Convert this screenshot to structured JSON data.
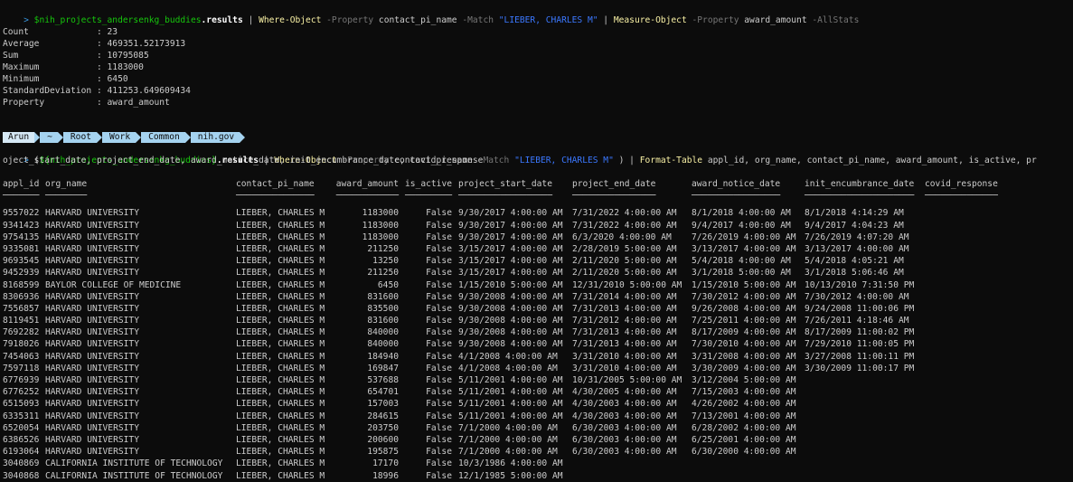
{
  "colors": {
    "background": "#0c0c0c",
    "text": "#cccccc",
    "variable": "#16c60c",
    "command": "#f9f1a5",
    "parameter": "#767676",
    "string": "#3b78ff",
    "prompt_caret": "#3a96dd",
    "prompt_segment": "#a5d3f0"
  },
  "command1": {
    "caret": ">",
    "variable": "$nih_projects_andersenkg_buddies",
    "member": ".results",
    "pipe1": " | ",
    "where": "Where-Object",
    "p1": " -Property ",
    "a1": "contact_pi_name",
    "p2": " -Match ",
    "s1": "\"LIEBER, CHARLES M\"",
    "pipe2": " | ",
    "measure": "Measure-Object",
    "p3": " -Property ",
    "a2": "award_amount",
    "p4": " -AllStats"
  },
  "stats": [
    {
      "label": "Count             ",
      "value": ": 23"
    },
    {
      "label": "Average           ",
      "value": ": 469351.52173913"
    },
    {
      "label": "Sum               ",
      "value": ": 10795085"
    },
    {
      "label": "Maximum           ",
      "value": ": 1183000"
    },
    {
      "label": "Minimum           ",
      "value": ": 6450"
    },
    {
      "label": "StandardDeviation ",
      "value": ": 411253.649609434"
    },
    {
      "label": "Property          ",
      "value": ": award_amount"
    }
  ],
  "prompt": {
    "user": "Arun",
    "segments": [
      "~",
      "Root",
      "Work",
      "Common",
      "nih.gov"
    ]
  },
  "command2": {
    "caret": ">",
    "open": "(",
    "variable": "${nih_projects_andersenkg_buddies}",
    "member": ".results",
    "pipe1": " | ",
    "where": "Where-Object",
    "p1": " -Property ",
    "a1": "contact_pi_name",
    "p2": " -Match ",
    "s1": "\"LIEBER, CHARLES M\"",
    "close": " ) | ",
    "format": "Format-Table",
    "args1": " appl_id, org_name, contact_pi_name, award_amount, is_active, pr",
    "args2": "oject_start_date, project_end_date, award_notice_date, init_encumbrance_date, covid_response"
  },
  "table": {
    "headers": [
      "appl_id",
      "org_name",
      "contact_pi_name",
      "award_amount",
      "is_active",
      "project_start_date",
      "project_end_date",
      "award_notice_date",
      "init_encumbrance_date",
      "covid_response"
    ],
    "underlines": [
      "───────",
      "────────",
      "───────────────",
      "────────────",
      "─────────",
      "──────────────────",
      "────────────────",
      "─────────────────",
      "─────────────────────",
      "──────────────"
    ],
    "rows": [
      [
        "9557022",
        "HARVARD UNIVERSITY",
        "LIEBER, CHARLES M",
        "1183000",
        "False",
        "9/30/2017 4:00:00 AM",
        "7/31/2022 4:00:00 AM",
        "8/1/2018 4:00:00 AM",
        "8/1/2018 4:14:29 AM",
        ""
      ],
      [
        "9341423",
        "HARVARD UNIVERSITY",
        "LIEBER, CHARLES M",
        "1183000",
        "False",
        "9/30/2017 4:00:00 AM",
        "7/31/2022 4:00:00 AM",
        "9/4/2017 4:00:00 AM",
        "9/4/2017 4:04:23 AM",
        ""
      ],
      [
        "9754135",
        "HARVARD UNIVERSITY",
        "LIEBER, CHARLES M",
        "1183000",
        "False",
        "9/30/2017 4:00:00 AM",
        "6/3/2020 4:00:00 AM",
        "7/26/2019 4:00:00 AM",
        "7/26/2019 4:07:20 AM",
        ""
      ],
      [
        "9335081",
        "HARVARD UNIVERSITY",
        "LIEBER, CHARLES M",
        "211250",
        "False",
        "3/15/2017 4:00:00 AM",
        "2/28/2019 5:00:00 AM",
        "3/13/2017 4:00:00 AM",
        "3/13/2017 4:00:00 AM",
        ""
      ],
      [
        "9693545",
        "HARVARD UNIVERSITY",
        "LIEBER, CHARLES M",
        "13250",
        "False",
        "3/15/2017 4:00:00 AM",
        "2/11/2020 5:00:00 AM",
        "5/4/2018 4:00:00 AM",
        "5/4/2018 4:05:21 AM",
        ""
      ],
      [
        "9452939",
        "HARVARD UNIVERSITY",
        "LIEBER, CHARLES M",
        "211250",
        "False",
        "3/15/2017 4:00:00 AM",
        "2/11/2020 5:00:00 AM",
        "3/1/2018 5:00:00 AM",
        "3/1/2018 5:06:46 AM",
        ""
      ],
      [
        "8168599",
        "BAYLOR COLLEGE OF MEDICINE",
        "LIEBER, CHARLES M",
        "6450",
        "False",
        "1/15/2010 5:00:00 AM",
        "12/31/2010 5:00:00 AM",
        "1/15/2010 5:00:00 AM",
        "10/13/2010 7:31:50 PM",
        ""
      ],
      [
        "8306936",
        "HARVARD UNIVERSITY",
        "LIEBER, CHARLES M",
        "831600",
        "False",
        "9/30/2008 4:00:00 AM",
        "7/31/2014 4:00:00 AM",
        "7/30/2012 4:00:00 AM",
        "7/30/2012 4:00:00 AM",
        ""
      ],
      [
        "7556857",
        "HARVARD UNIVERSITY",
        "LIEBER, CHARLES M",
        "835500",
        "False",
        "9/30/2008 4:00:00 AM",
        "7/31/2013 4:00:00 AM",
        "9/26/2008 4:00:00 AM",
        "9/24/2008 11:00:06 PM",
        ""
      ],
      [
        "8119451",
        "HARVARD UNIVERSITY",
        "LIEBER, CHARLES M",
        "831600",
        "False",
        "9/30/2008 4:00:00 AM",
        "7/31/2012 4:00:00 AM",
        "7/25/2011 4:00:00 AM",
        "7/26/2011 4:18:46 AM",
        ""
      ],
      [
        "7692282",
        "HARVARD UNIVERSITY",
        "LIEBER, CHARLES M",
        "840000",
        "False",
        "9/30/2008 4:00:00 AM",
        "7/31/2013 4:00:00 AM",
        "8/17/2009 4:00:00 AM",
        "8/17/2009 11:00:02 PM",
        ""
      ],
      [
        "7918026",
        "HARVARD UNIVERSITY",
        "LIEBER, CHARLES M",
        "840000",
        "False",
        "9/30/2008 4:00:00 AM",
        "7/31/2013 4:00:00 AM",
        "7/30/2010 4:00:00 AM",
        "7/29/2010 11:00:05 PM",
        ""
      ],
      [
        "7454063",
        "HARVARD UNIVERSITY",
        "LIEBER, CHARLES M",
        "184940",
        "False",
        "4/1/2008 4:00:00 AM",
        "3/31/2010 4:00:00 AM",
        "3/31/2008 4:00:00 AM",
        "3/27/2008 11:00:11 PM",
        ""
      ],
      [
        "7597118",
        "HARVARD UNIVERSITY",
        "LIEBER, CHARLES M",
        "169847",
        "False",
        "4/1/2008 4:00:00 AM",
        "3/31/2010 4:00:00 AM",
        "3/30/2009 4:00:00 AM",
        "3/30/2009 11:00:17 PM",
        ""
      ],
      [
        "6776939",
        "HARVARD UNIVERSITY",
        "LIEBER, CHARLES M",
        "537688",
        "False",
        "5/11/2001 4:00:00 AM",
        "10/31/2005 5:00:00 AM",
        "3/12/2004 5:00:00 AM",
        "",
        ""
      ],
      [
        "6776252",
        "HARVARD UNIVERSITY",
        "LIEBER, CHARLES M",
        "654701",
        "False",
        "5/11/2001 4:00:00 AM",
        "4/30/2005 4:00:00 AM",
        "7/15/2003 4:00:00 AM",
        "",
        ""
      ],
      [
        "6515093",
        "HARVARD UNIVERSITY",
        "LIEBER, CHARLES M",
        "157003",
        "False",
        "5/11/2001 4:00:00 AM",
        "4/30/2003 4:00:00 AM",
        "4/26/2002 4:00:00 AM",
        "",
        ""
      ],
      [
        "6335311",
        "HARVARD UNIVERSITY",
        "LIEBER, CHARLES M",
        "284615",
        "False",
        "5/11/2001 4:00:00 AM",
        "4/30/2003 4:00:00 AM",
        "7/13/2001 4:00:00 AM",
        "",
        ""
      ],
      [
        "6520054",
        "HARVARD UNIVERSITY",
        "LIEBER, CHARLES M",
        "203750",
        "False",
        "7/1/2000 4:00:00 AM",
        "6/30/2003 4:00:00 AM",
        "6/28/2002 4:00:00 AM",
        "",
        ""
      ],
      [
        "6386526",
        "HARVARD UNIVERSITY",
        "LIEBER, CHARLES M",
        "200600",
        "False",
        "7/1/2000 4:00:00 AM",
        "6/30/2003 4:00:00 AM",
        "6/25/2001 4:00:00 AM",
        "",
        ""
      ],
      [
        "6193064",
        "HARVARD UNIVERSITY",
        "LIEBER, CHARLES M",
        "195875",
        "False",
        "7/1/2000 4:00:00 AM",
        "6/30/2003 4:00:00 AM",
        "6/30/2000 4:00:00 AM",
        "",
        ""
      ],
      [
        "3040869",
        "CALIFORNIA INSTITUTE OF TECHNOLOGY",
        "LIEBER, CHARLES M",
        "17170",
        "False",
        "10/3/1986 4:00:00 AM",
        "",
        "",
        "",
        ""
      ],
      [
        "3040868",
        "CALIFORNIA INSTITUTE OF TECHNOLOGY",
        "LIEBER, CHARLES M",
        "18996",
        "False",
        "12/1/1985 5:00:00 AM",
        "",
        "",
        "",
        ""
      ]
    ]
  }
}
